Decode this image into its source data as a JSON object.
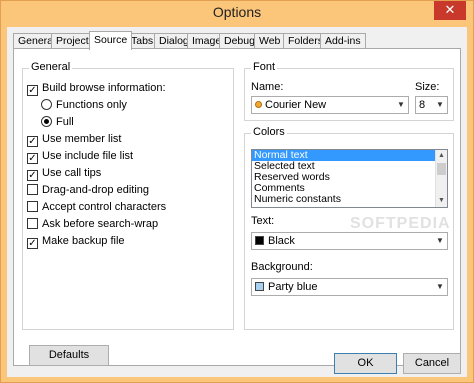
{
  "window": {
    "title": "Options",
    "close_glyph": "✕"
  },
  "tabs": [
    {
      "label": "General"
    },
    {
      "label": "Project"
    },
    {
      "label": "Source",
      "active": true
    },
    {
      "label": "Tabs"
    },
    {
      "label": "Dialog"
    },
    {
      "label": "Image"
    },
    {
      "label": "Debug"
    },
    {
      "label": "Web"
    },
    {
      "label": "Folders"
    },
    {
      "label": "Add-ins"
    }
  ],
  "general": {
    "title": "General",
    "build_browse": {
      "label": "Build browse information:",
      "checked": true
    },
    "functions_only": {
      "label": "Functions only",
      "selected": false
    },
    "full": {
      "label": "Full",
      "selected": true
    },
    "use_member_list": {
      "label": "Use member list",
      "checked": true
    },
    "use_include_list": {
      "label": "Use include file list",
      "checked": true
    },
    "use_call_tips": {
      "label": "Use call tips",
      "checked": true
    },
    "drag_drop": {
      "label": "Drag-and-drop editing",
      "checked": false
    },
    "accept_control": {
      "label": "Accept control characters",
      "checked": false
    },
    "ask_search_wrap": {
      "label": "Ask before search-wrap",
      "checked": false
    },
    "make_backup": {
      "label": "Make backup file",
      "checked": true
    }
  },
  "font": {
    "title": "Font",
    "name_label": "Name:",
    "name_value": "Courier New",
    "size_label": "Size:",
    "size_value": "8"
  },
  "colors": {
    "title": "Colors",
    "items": [
      "Normal text",
      "Selected text",
      "Reserved words",
      "Comments",
      "Numeric constants"
    ],
    "selected_index": 0,
    "text_label": "Text:",
    "text_value": "Black",
    "text_color": "#000000",
    "background_label": "Background:",
    "background_value": "Party blue",
    "background_color": "#a8d0f0"
  },
  "watermark": "SOFTPEDIA",
  "buttons": {
    "defaults": "Defaults",
    "ok": "OK",
    "cancel": "Cancel"
  }
}
